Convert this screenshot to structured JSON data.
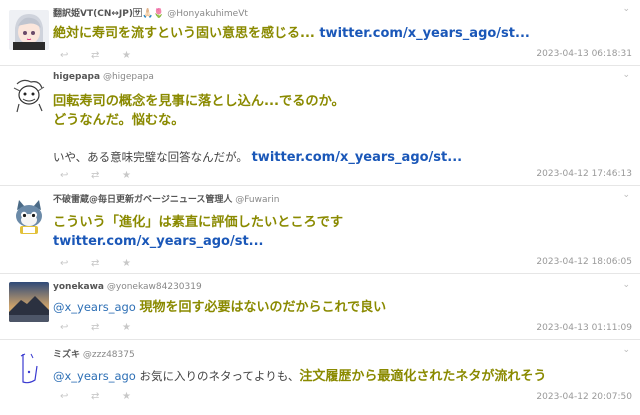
{
  "tweets": [
    {
      "display_name": "翻訳姫VT(CN↔JP)🈂🙏🏻🌷",
      "handle": "@HonyakuhimeVt",
      "lines": [
        [
          {
            "t": "big",
            "v": "絶対に寿司を流すという固い意思を感じる... "
          },
          {
            "t": "link",
            "v": "twitter.com/x_years_ago/st..."
          }
        ]
      ],
      "timestamp": "2023-04-13 06:18:31",
      "avatar": "anime-girl-icon"
    },
    {
      "display_name": "higepapa",
      "handle": "@higepapa",
      "lines": [
        [
          {
            "t": "big",
            "v": "回転寿司の概念を見事に落とし込ん...でるのか。"
          }
        ],
        [
          {
            "t": "big",
            "v": "どうなんだ。悩むな。"
          }
        ],
        [],
        [
          {
            "t": "plain",
            "v": "いや、ある意味完璧な回答なんだが。 "
          },
          {
            "t": "link",
            "v": "twitter.com/x_years_ago/st..."
          }
        ]
      ],
      "timestamp": "2023-04-12 17:46:13",
      "avatar": "sketch-character-icon"
    },
    {
      "display_name": "不破雷蔵@毎日更新ガベージニュース管理人",
      "handle": "@Fuwarin",
      "lines": [
        [
          {
            "t": "big",
            "v": "こういう「進化」は素直に評価したいところです"
          }
        ],
        [
          {
            "t": "link",
            "v": "twitter.com/x_years_ago/st..."
          }
        ]
      ],
      "timestamp": "2023-04-12 18:06:05",
      "avatar": "cat-character-icon"
    },
    {
      "display_name": "yonekawa",
      "handle": "@yonekaw84230319",
      "lines": [
        [
          {
            "t": "mention",
            "v": "@x_years_ago "
          },
          {
            "t": "big",
            "v": "現物を回す必要はないのだからこれで良い"
          }
        ]
      ],
      "timestamp": "2023-04-13 01:11:09",
      "avatar": "mountain-photo-icon"
    },
    {
      "display_name": "ミズキ",
      "handle": "@zzz48375",
      "lines": [
        [
          {
            "t": "mention",
            "v": "@x_years_ago "
          },
          {
            "t": "plain",
            "v": "お気に入りのネタってよりも、"
          },
          {
            "t": "big",
            "v": "注文履歴から最適化されたネタが流れそう"
          }
        ]
      ],
      "timestamp": "2023-04-12 20:07:50",
      "avatar": "doodle-icon"
    }
  ],
  "action_icons": [
    "reply-icon",
    "retweet-icon",
    "like-icon"
  ],
  "action_glyphs": [
    "↩",
    "⇄",
    "★"
  ],
  "menu_glyph": "⌄"
}
